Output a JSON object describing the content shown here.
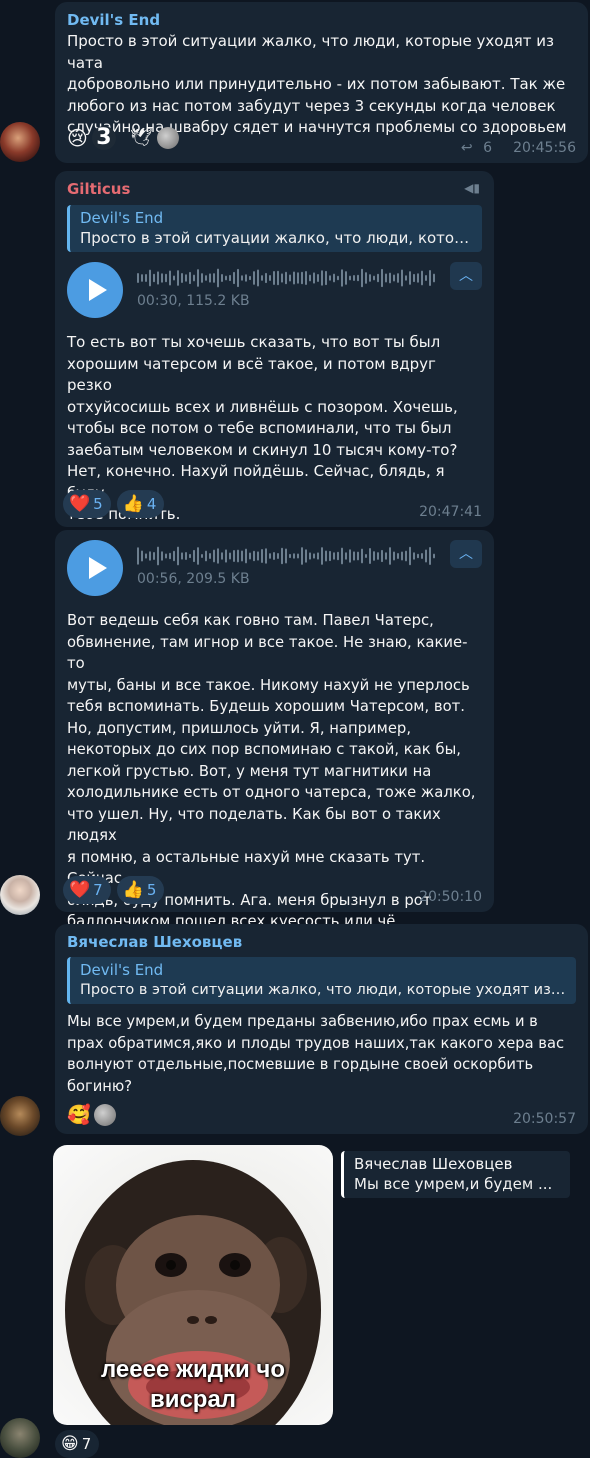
{
  "colors": {
    "background": "#0e1621",
    "bubble": "#182533",
    "accent": "#6ab2f2",
    "name_devils_end": "#71baf2",
    "name_gilticus": "#e56b72",
    "name_vyacheslav": "#71baf2",
    "time": "#6d7f8f"
  },
  "msg1": {
    "sender": "Devil's End",
    "text": "Просто в этой ситуации жалко, что люди, которые уходят из чата\nдобровольно или принудительно - их потом забывают. Так же\nлюбого из нас потом забудут через 3 секунды когда человек\nслучайно на швабру сядет и начнутся проблемы со здоровьем",
    "reactions": [
      {
        "icon": "crying-face",
        "emoji": "😢",
        "count": ""
      },
      {
        "icon": "number-three-sticker",
        "emoji": "3",
        "count": ""
      },
      {
        "icon": "dove-sticker",
        "emoji": "🕊",
        "count": ""
      },
      {
        "icon": "grey-blob-sticker",
        "emoji": "●",
        "count": ""
      }
    ],
    "replies": "6",
    "time": "20:45:56"
  },
  "msg2": {
    "sender": "Gilticus",
    "reply_name": "Devil's End",
    "reply_text": "Просто в этой ситуации жалко, что люди, которы...",
    "voice_info": "00:30, 115.2 KB",
    "text": "То есть вот ты хочешь сказать, что вот ты был\nхорошим чатерсом и всё такое, и потом вдруг резко\nотхуйсосишь всех и ливнёшь с позором. Хочешь,\nчтобы все потом о тебе вспоминали, что ты был\nзаебатым человеком и скинул 10 тысяч кому-то?\nНет, конечно. Нахуй пойдёшь. Сейчас, блядь, я буду\nтебе помнить.",
    "reactions": [
      {
        "icon": "heart",
        "emoji": "❤️",
        "count": "5"
      },
      {
        "icon": "thumbs-up",
        "emoji": "👍",
        "count": "4"
      }
    ],
    "time": "20:47:41"
  },
  "msg3": {
    "voice_info": "00:56, 209.5 KB",
    "text": "Вот ведешь себя как говно там. Павел Чатерс,\nобвинение, там игнор и все такое. Не знаю, какие-то\nмуты, баны и все такое. Никому нахуй не уперлось\nтебя вспоминать. Будешь хорошим Чатерсом, вот.\nНо, допустим, пришлось уйти. Я, например,\nнекоторых до сих пор вспоминаю с такой, как бы,\nлегкой грустью. Вот, у меня тут магнитики на\nхолодильнике есть от одного чатерса, тоже жалко,\nчто ушел. Ну, что поделать. Как бы вот о таких людях\nя помню, а остальные нахуй мне сказать тут. Сейчас,\nблядь, буду помнить. Ага. меня брызнул в рот\nбаллончиком пошел всех куесость или чё",
    "reactions": [
      {
        "icon": "heart",
        "emoji": "❤️",
        "count": "7"
      },
      {
        "icon": "thumbs-up",
        "emoji": "👍",
        "count": "5"
      }
    ],
    "time": "20:50:10"
  },
  "msg4": {
    "sender": "Вячеслав Шеховцев",
    "reply_name": "Devil's End",
    "reply_text": "Просто в этой ситуации жалко, что люди, которые уходят из ...",
    "text": "Мы все умрем,и будем преданы забвению,ибо прах есмь и в\nпрах обратимся,яко и плоды трудов наших,так какого хера вас\nволнуют отдельные,посмевшие в гордыне своей оскорбить\nбогиню?",
    "reactions": [
      {
        "icon": "smiling-face-with-hearts",
        "emoji": "🥰",
        "count": ""
      },
      {
        "icon": "grey-blob-sticker",
        "emoji": "●",
        "count": ""
      }
    ],
    "time": "20:50:57"
  },
  "msg5": {
    "caption": "лееее жидки чо\nвисрал",
    "reply_name": "Вячеслав Шеховцев",
    "reply_text": "Мы все умрем,и будем ...",
    "reaction_emoji": "😁",
    "reaction_icon": "grinning-face",
    "reaction_count": "7"
  }
}
